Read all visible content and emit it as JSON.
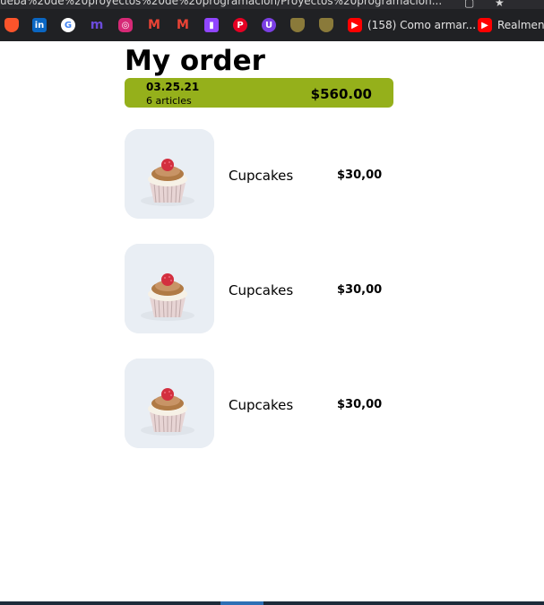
{
  "browser": {
    "url_fragment": "ueba%20de%20proyectos%20de%20programacion/Proyectos%20programacion..."
  },
  "bookmarks": [
    {
      "icon": "brave-icon",
      "color": "#fb542b",
      "label": ""
    },
    {
      "icon": "linkedin-icon",
      "color": "#0a66c2",
      "label": ""
    },
    {
      "icon": "google-icon",
      "color": "#ffffff",
      "label": ""
    },
    {
      "icon": "m-app-icon",
      "color": "#6b4bdb",
      "label": ""
    },
    {
      "icon": "instagram-icon",
      "color": "#d62976",
      "label": ""
    },
    {
      "icon": "gmail-icon",
      "color": "#ea4335",
      "label": ""
    },
    {
      "icon": "gmail-icon",
      "color": "#ea4335",
      "label": ""
    },
    {
      "icon": "twitch-icon",
      "color": "#9146ff",
      "label": ""
    },
    {
      "icon": "pinterest-icon",
      "color": "#e60023",
      "label": ""
    },
    {
      "icon": "u-app-icon",
      "color": "#7b3fe4",
      "label": ""
    },
    {
      "icon": "shield-icon",
      "color": "#8a7a3a",
      "label": ""
    },
    {
      "icon": "shield-icon",
      "color": "#8a7a3a",
      "label": ""
    },
    {
      "icon": "youtube-icon",
      "color": "#ff0000",
      "label": "(158) Como armar..."
    },
    {
      "icon": "youtube-icon",
      "color": "#ff0000",
      "label": "Realment"
    }
  ],
  "page": {
    "title": "My order",
    "summary": {
      "date": "03.25.21",
      "articles": "6 articles",
      "total": "$560.00",
      "accent": "#95b01b"
    },
    "items": [
      {
        "name": "Cupcakes",
        "price": "$30,00"
      },
      {
        "name": "Cupcakes",
        "price": "$30,00"
      },
      {
        "name": "Cupcakes",
        "price": "$30,00"
      }
    ]
  }
}
